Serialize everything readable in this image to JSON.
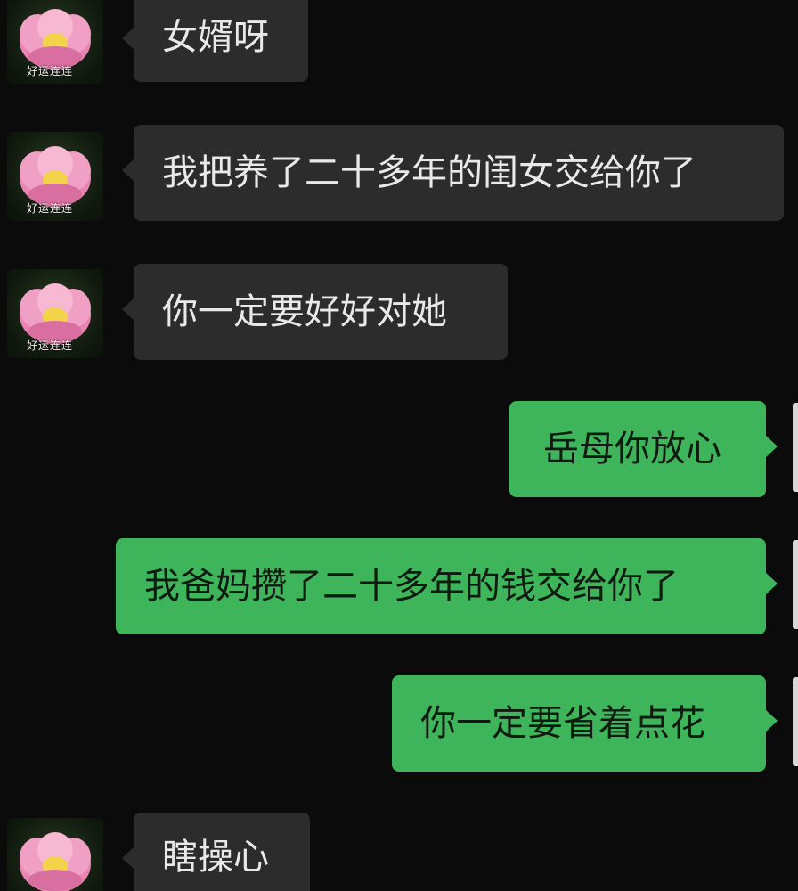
{
  "avatar_caption": "好运连连",
  "messages": [
    {
      "side": "in",
      "text": "女婿呀"
    },
    {
      "side": "in",
      "text": "我把养了二十多年的闺女交给你了"
    },
    {
      "side": "in",
      "text": "你一定要好好对她"
    },
    {
      "side": "out",
      "text": "岳母你放心"
    },
    {
      "side": "out",
      "text": "我爸妈攒了二十多年的钱交给你了"
    },
    {
      "side": "out",
      "text": "你一定要省着点花"
    },
    {
      "side": "in",
      "text": "瞎操心"
    }
  ],
  "colors": {
    "background": "#0b0b0b",
    "incoming_bubble": "#2c2c2c",
    "outgoing_bubble": "#3eb55a"
  },
  "icons": {
    "avatar": "lotus-flower-icon"
  }
}
